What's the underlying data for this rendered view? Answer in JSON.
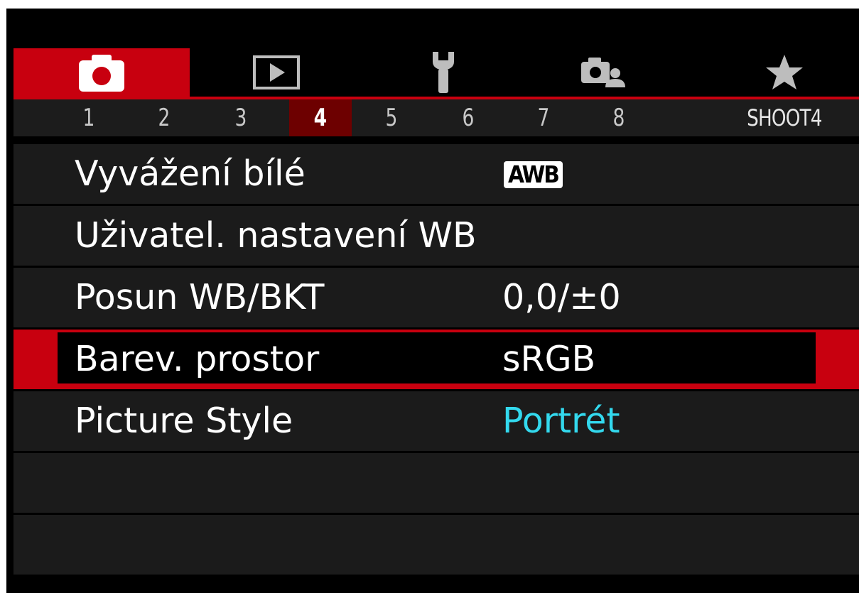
{
  "tabs": {
    "items": [
      {
        "icon": "camera-icon",
        "active": true
      },
      {
        "icon": "playback-icon",
        "active": false
      },
      {
        "icon": "wrench-icon",
        "active": false
      },
      {
        "icon": "custom-functions-icon",
        "active": false
      },
      {
        "icon": "star-icon",
        "active": false
      }
    ]
  },
  "sub_tabs": {
    "numbers": [
      "1",
      "2",
      "3",
      "4",
      "5",
      "6",
      "7",
      "8"
    ],
    "active_index": 3,
    "page_name": "SHOOT4"
  },
  "menu": {
    "rows": [
      {
        "label": "Vyvážení bílé",
        "value": "AWB",
        "value_style": "badge"
      },
      {
        "label": "Uživatel. nastavení WB",
        "value": ""
      },
      {
        "label": "Posun WB/BKT",
        "value": "0,0/±0"
      },
      {
        "label": "Barev. prostor",
        "value": "sRGB",
        "selected": true
      },
      {
        "label": "Picture Style",
        "value": "Portrét",
        "value_color": "#33d9ee"
      },
      {
        "label": "",
        "value": ""
      },
      {
        "label": "",
        "value": ""
      }
    ]
  },
  "colors": {
    "accent": "#c8000f",
    "active_subtab": "#6d0000",
    "value_cyan": "#33d9ee",
    "row_background": "#1b1b1b"
  }
}
